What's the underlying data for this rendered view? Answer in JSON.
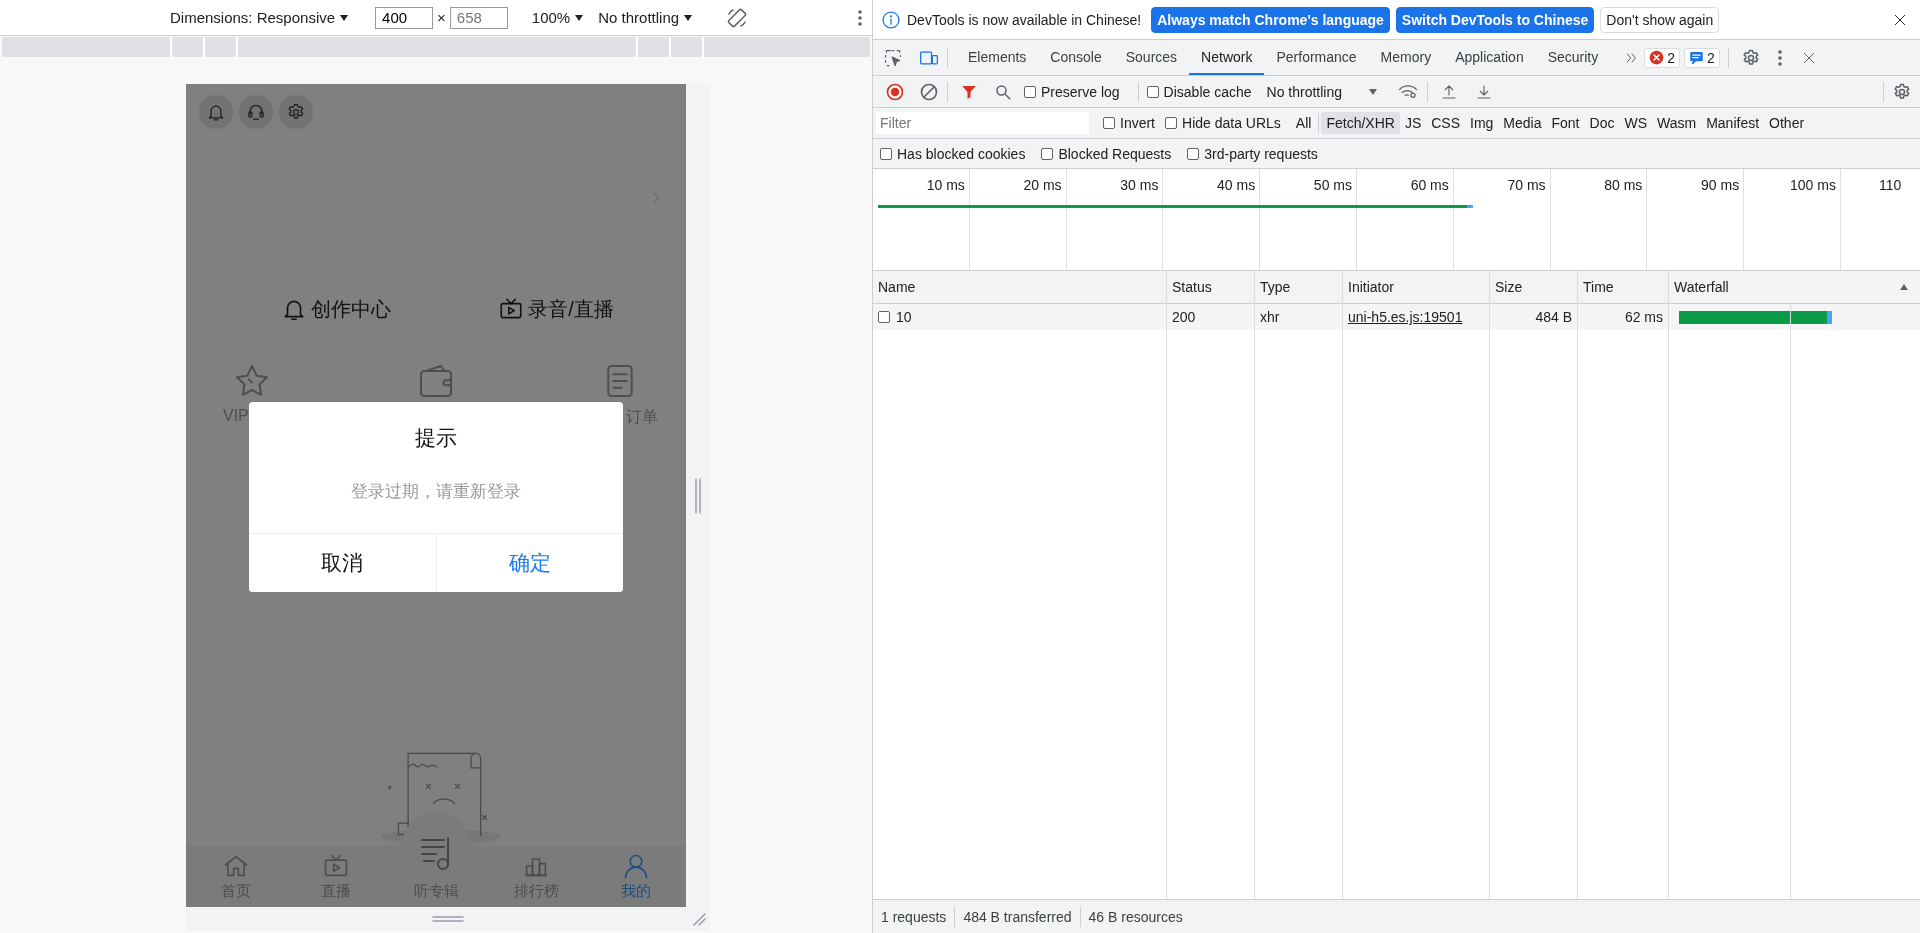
{
  "device_toolbar": {
    "dimensions": "Dimensions: Responsive",
    "width_value": "400",
    "times": "×",
    "height_placeholder": "658",
    "zoom": "100%",
    "throttling": "No throttling"
  },
  "app": {
    "shortcuts": [
      {
        "label": "创作中心",
        "kind": "bell"
      },
      {
        "label": "录音/直播",
        "kind": "tv"
      }
    ],
    "grid": [
      {
        "label": "VIP",
        "kind": "star"
      },
      {
        "kind": "wallet"
      },
      {
        "label": "订单",
        "kind": "doc"
      }
    ],
    "dialog": {
      "title": "提示",
      "message": "登录过期，请重新登录",
      "buttons": [
        {
          "label": "取消",
          "primary": false
        },
        {
          "label": "确定",
          "primary": true
        }
      ]
    },
    "tabbar": [
      {
        "label": "首页",
        "kind": "home",
        "selected": false
      },
      {
        "label": "直播",
        "kind": "tv",
        "selected": false
      },
      {
        "label": "听专辑",
        "kind": "album",
        "selected": false
      },
      {
        "label": "排行榜",
        "kind": "ranking",
        "selected": false
      },
      {
        "label": "我的",
        "kind": "person",
        "selected": true
      }
    ]
  },
  "devtools": {
    "infobar": {
      "message": "DevTools is now available in Chinese!",
      "buttons": [
        {
          "label": "Always match Chrome's language",
          "primary": true
        },
        {
          "label": "Switch DevTools to Chinese",
          "primary": true
        },
        {
          "label": "Don't show again",
          "primary": false
        }
      ]
    },
    "device_mode": true,
    "tabs": [
      {
        "label": "Elements",
        "selected": false
      },
      {
        "label": "Console",
        "selected": false
      },
      {
        "label": "Sources",
        "selected": false
      },
      {
        "label": "Network",
        "selected": true
      },
      {
        "label": "Performance",
        "selected": false
      },
      {
        "label": "Memory",
        "selected": false
      },
      {
        "label": "Application",
        "selected": false
      },
      {
        "label": "Security",
        "selected": false
      }
    ],
    "error_count": "2",
    "message_count": "2",
    "toolbar": {
      "recording": true,
      "preserve_log": {
        "label": "Preserve log",
        "checked": false
      },
      "disable_cache": {
        "label": "Disable cache",
        "checked": false
      },
      "throttling": "No throttling"
    },
    "filter": {
      "placeholder": "Filter",
      "options": [
        {
          "label": "Invert",
          "checked": false
        },
        {
          "label": "Hide data URLs",
          "checked": false
        }
      ],
      "types": [
        {
          "label": "All",
          "selected": false
        },
        {
          "label": "Fetch/XHR",
          "selected": true
        },
        {
          "label": "JS",
          "selected": false
        },
        {
          "label": "CSS",
          "selected": false
        },
        {
          "label": "Img",
          "selected": false
        },
        {
          "label": "Media",
          "selected": false
        },
        {
          "label": "Font",
          "selected": false
        },
        {
          "label": "Doc",
          "selected": false
        },
        {
          "label": "WS",
          "selected": false
        },
        {
          "label": "Wasm",
          "selected": false
        },
        {
          "label": "Manifest",
          "selected": false
        },
        {
          "label": "Other",
          "selected": false
        }
      ]
    },
    "extra_filters": [
      {
        "label": "Has blocked cookies",
        "checked": false
      },
      {
        "label": "Blocked Requests",
        "checked": false
      },
      {
        "label": "3rd-party requests",
        "checked": false
      }
    ],
    "timeline": {
      "ticks": [
        "10 ms",
        "20 ms",
        "30 ms",
        "40 ms",
        "50 ms",
        "60 ms",
        "70 ms",
        "80 ms",
        "90 ms",
        "100 ms",
        "110"
      ]
    },
    "table": {
      "columns": [
        "Name",
        "Status",
        "Type",
        "Initiator",
        "Size",
        "Time",
        "Waterfall"
      ],
      "rows": [
        {
          "checked": false,
          "cells": [
            "10",
            "200",
            "xhr",
            "uni-h5.es.js:19501",
            "484 B",
            "62 ms"
          ]
        }
      ]
    },
    "status_bar": [
      "1 requests",
      "484 B transferred",
      "46 B resources"
    ]
  }
}
